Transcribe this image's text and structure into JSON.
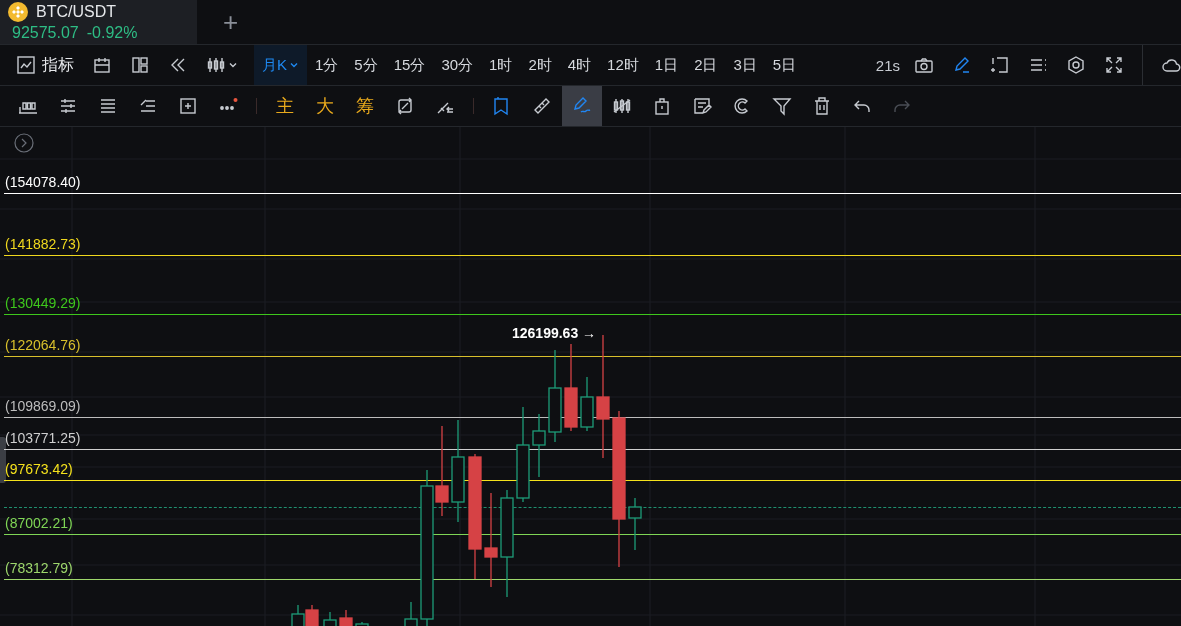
{
  "tab": {
    "symbol": "BTC/USDT",
    "price": "92575.07",
    "change": "-0.92%"
  },
  "new_tab": "+",
  "toolbar": {
    "indicator_label": "指标",
    "intervals": [
      {
        "label": "月K",
        "selected": true
      },
      {
        "label": "1分",
        "selected": false
      },
      {
        "label": "5分",
        "selected": false
      },
      {
        "label": "15分",
        "selected": false
      },
      {
        "label": "30分",
        "selected": false
      },
      {
        "label": "1时",
        "selected": false
      },
      {
        "label": "2时",
        "selected": false
      },
      {
        "label": "4时",
        "selected": false
      },
      {
        "label": "12时",
        "selected": false
      },
      {
        "label": "1日",
        "selected": false
      },
      {
        "label": "2日",
        "selected": false
      },
      {
        "label": "3日",
        "selected": false
      },
      {
        "label": "5日",
        "selected": false
      }
    ],
    "timer": "21s",
    "right_tools": [
      {
        "on": false
      },
      {
        "on": true
      },
      {
        "on": false
      },
      {
        "on": false
      },
      {
        "on": false
      },
      {
        "on": false
      },
      {
        "on": false
      }
    ]
  },
  "drawing_toolbar": [
    {
      "kind": "icon",
      "selected": false,
      "on": false
    },
    {
      "kind": "icon",
      "selected": false,
      "on": false
    },
    {
      "kind": "icon",
      "selected": false,
      "on": false
    },
    {
      "kind": "icon",
      "selected": false,
      "on": false
    },
    {
      "kind": "icon",
      "selected": false,
      "on": false
    },
    {
      "kind": "icon",
      "selected": false,
      "on": false
    },
    {
      "kind": "separator"
    },
    {
      "kind": "text",
      "label": "主"
    },
    {
      "kind": "text",
      "label": "大"
    },
    {
      "kind": "text",
      "label": "筹"
    },
    {
      "kind": "icon",
      "selected": false,
      "on": false
    },
    {
      "kind": "icon",
      "selected": false,
      "on": false
    },
    {
      "kind": "separator"
    },
    {
      "kind": "icon",
      "selected": false,
      "on": true
    },
    {
      "kind": "icon",
      "selected": false,
      "on": false
    },
    {
      "kind": "icon",
      "selected": true,
      "on": true
    },
    {
      "kind": "icon",
      "selected": false,
      "on": false
    },
    {
      "kind": "icon",
      "selected": false,
      "on": false
    },
    {
      "kind": "icon",
      "selected": false,
      "on": false
    },
    {
      "kind": "icon",
      "selected": false,
      "on": false
    },
    {
      "kind": "icon",
      "selected": false,
      "on": false
    },
    {
      "kind": "icon",
      "selected": false,
      "on": false
    },
    {
      "kind": "icon",
      "selected": false,
      "on": false
    },
    {
      "kind": "icon",
      "selected": false,
      "on": false,
      "disabled": true
    }
  ],
  "chart": {
    "high_label": "126199.63 →",
    "levels": [
      {
        "label": "(154078.40)",
        "color": "#ffffff"
      },
      {
        "label": "(141882.73)",
        "color": "#f0d81e"
      },
      {
        "label": "(130449.29)",
        "color": "#3ec71c"
      },
      {
        "label": "(122064.76)",
        "color": "#d8c02c"
      },
      {
        "label": "(109869.09)",
        "color": "#bdbdbd"
      },
      {
        "label": "(103771.25)",
        "color": "#cfcfcf"
      },
      {
        "label": "(97673.42)",
        "color": "#f5e21c"
      },
      {
        "label": "(87002.21)",
        "color": "#7fd655"
      },
      {
        "label": "(78312.79)",
        "color": "#9ed86c"
      }
    ]
  }
}
